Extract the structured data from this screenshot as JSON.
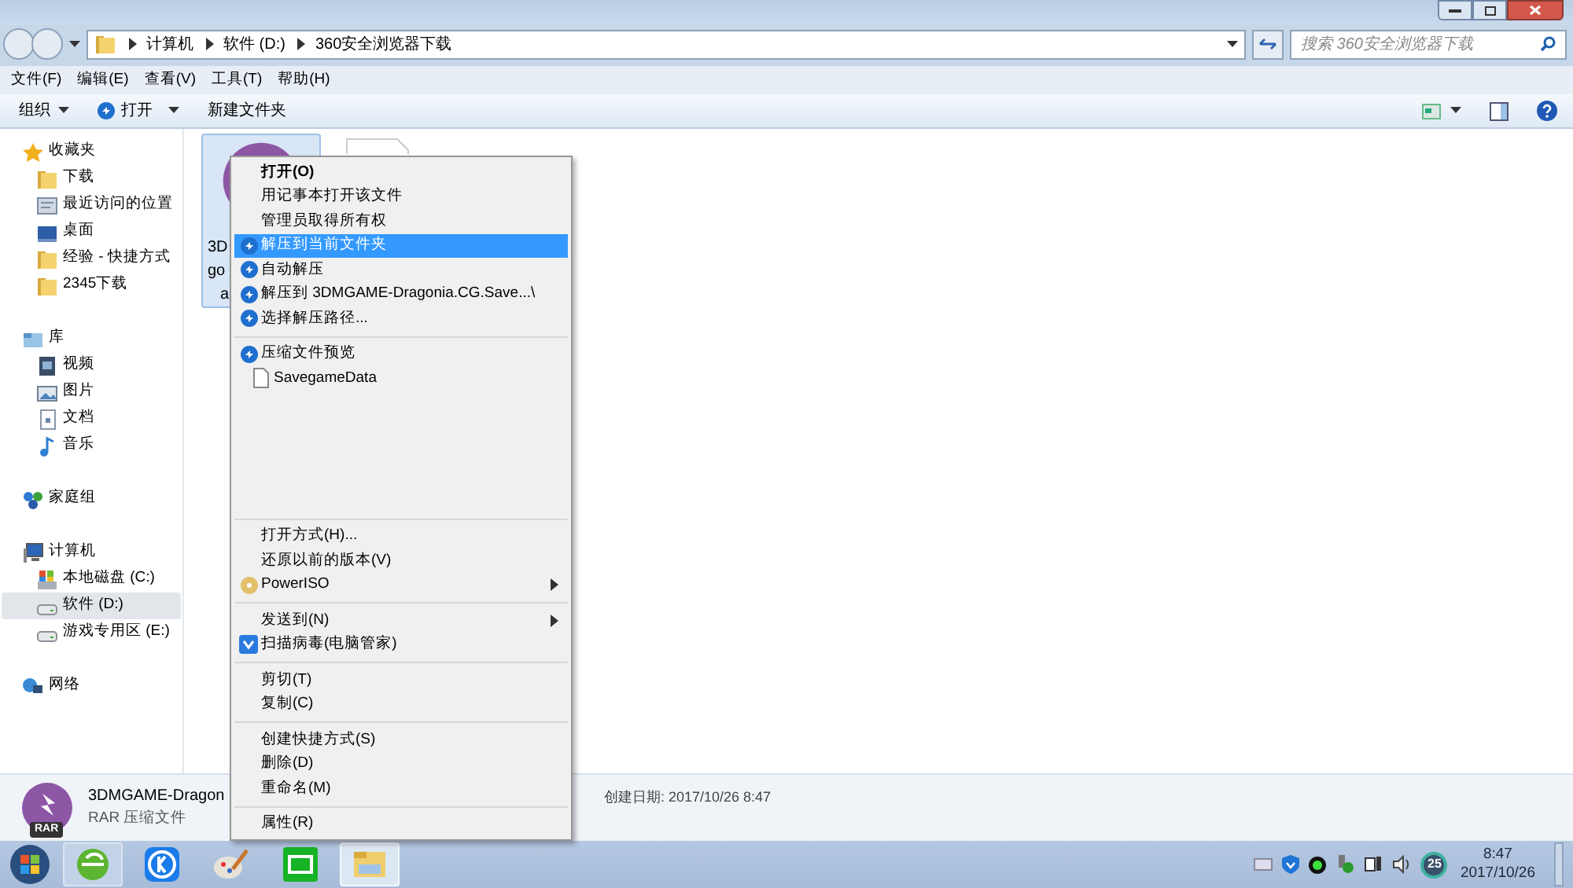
{
  "address": {
    "crumbs": [
      "计算机",
      "软件 (D:)",
      "360安全浏览器下载"
    ]
  },
  "search": {
    "placeholder": "搜索 360安全浏览器下载"
  },
  "menubar": [
    "文件(F)",
    "编辑(E)",
    "查看(V)",
    "工具(T)",
    "帮助(H)"
  ],
  "toolbar": [
    {
      "label": "组织",
      "kind": "dropdown"
    },
    {
      "label": "打开",
      "kind": "open"
    },
    {
      "label": "新建文件夹",
      "kind": "plain"
    }
  ],
  "sidebar": [
    {
      "label": "收藏夹",
      "kind": "star",
      "children": [
        {
          "label": "下载",
          "kind": "folder",
          "selected": false
        },
        {
          "label": "最近访问的位置",
          "kind": "recent",
          "selected": false
        },
        {
          "label": "桌面",
          "kind": "desktop",
          "selected": false
        },
        {
          "label": "经验 - 快捷方式",
          "kind": "folder",
          "selected": false
        },
        {
          "label": "2345下载",
          "kind": "folder",
          "selected": false
        }
      ]
    },
    {
      "label": "库",
      "kind": "library",
      "children": [
        {
          "label": "视频",
          "kind": "video",
          "selected": false
        },
        {
          "label": "图片",
          "kind": "picture",
          "selected": false
        },
        {
          "label": "文档",
          "kind": "doc",
          "selected": false
        },
        {
          "label": "音乐",
          "kind": "music",
          "selected": false
        }
      ]
    },
    {
      "label": "家庭组",
      "kind": "homegroup"
    },
    {
      "label": "计算机",
      "kind": "computer",
      "children": [
        {
          "label": "本地磁盘 (C:)",
          "kind": "sysdrive",
          "selected": false
        },
        {
          "label": "软件 (D:)",
          "kind": "drive",
          "selected": true
        },
        {
          "label": "游戏专用区 (E:)",
          "kind": "drive",
          "selected": false
        }
      ]
    },
    {
      "label": "网络",
      "kind": "network"
    }
  ],
  "file": {
    "label_lines": [
      "3D",
      "go",
      "a"
    ],
    "selected": true
  },
  "context_menu": [
    [
      {
        "label": "打开(O)",
        "kind": "plain",
        "bold": true,
        "selected": false
      },
      {
        "label": "用记事本打开该文件",
        "kind": "plain",
        "selected": false
      },
      {
        "label": "管理员取得所有权",
        "kind": "plain",
        "selected": false
      },
      {
        "label": "解压到当前文件夹",
        "kind": "extract",
        "selected": true
      },
      {
        "label": "自动解压",
        "kind": "extract",
        "selected": false
      },
      {
        "label": "解压到 3DMGAME-Dragonia.CG.Save...\\",
        "kind": "extract",
        "selected": false
      },
      {
        "label": "选择解压路径...",
        "kind": "extract",
        "selected": false
      }
    ],
    [
      {
        "label": "压缩文件预览",
        "kind": "extract",
        "selected": false
      },
      {
        "label": "SavegameData",
        "kind": "file",
        "selected": false
      }
    ],
    [
      {
        "label": "打开方式(H)...",
        "kind": "plain",
        "selected": false
      },
      {
        "label": "还原以前的版本(V)",
        "kind": "plain",
        "selected": false
      },
      {
        "label": "PowerISO",
        "kind": "disc",
        "submenu": true,
        "selected": false
      }
    ],
    [
      {
        "label": "发送到(N)",
        "kind": "plain",
        "submenu": true,
        "selected": false
      },
      {
        "label": "扫描病毒(电脑管家)",
        "kind": "shield",
        "selected": false
      }
    ],
    [
      {
        "label": "剪切(T)",
        "kind": "plain",
        "selected": false
      },
      {
        "label": "复制(C)",
        "kind": "plain",
        "selected": false
      }
    ],
    [
      {
        "label": "创建快捷方式(S)",
        "kind": "plain",
        "selected": false
      },
      {
        "label": "删除(D)",
        "kind": "plain",
        "selected": false
      },
      {
        "label": "重命名(M)",
        "kind": "plain",
        "selected": false
      }
    ],
    [
      {
        "label": "属性(R)",
        "kind": "plain",
        "selected": false
      }
    ]
  ],
  "details": {
    "name": "3DMGAME-Dragon",
    "type": "RAR 压缩文件",
    "badge": "RAR",
    "created": "创建日期: 2017/10/26 8:47"
  },
  "taskbar": {
    "apps": [
      {
        "kind": "browser",
        "active": false
      },
      {
        "kind": "k",
        "active": false
      },
      {
        "kind": "paint",
        "active": false
      },
      {
        "kind": "video",
        "active": false
      },
      {
        "kind": "explorer",
        "active": true
      }
    ],
    "tray_badge": "25",
    "time": "8:47",
    "date": "2017/10/26"
  }
}
